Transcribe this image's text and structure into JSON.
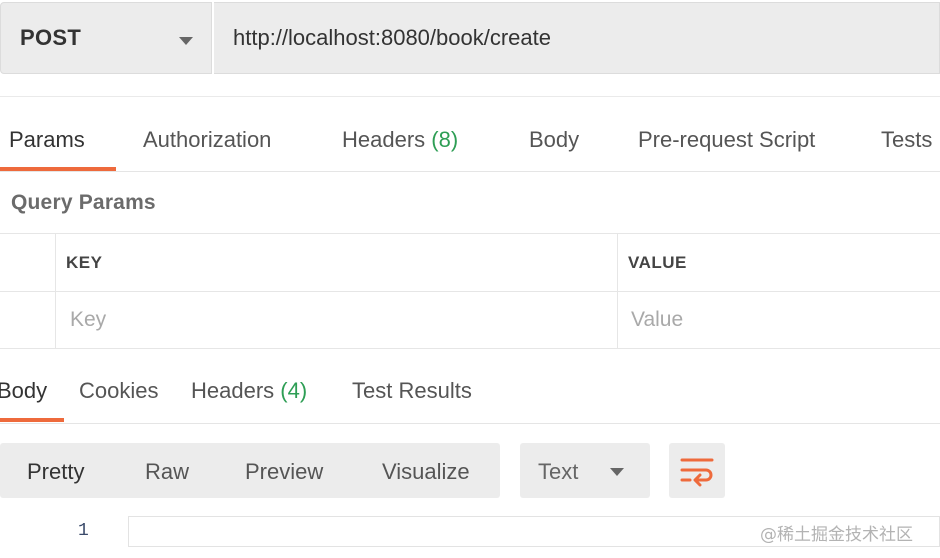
{
  "request": {
    "method": "POST",
    "url": "http://localhost:8080/book/create"
  },
  "request_tabs": {
    "params": "Params",
    "authorization": "Authorization",
    "headers_label": "Headers",
    "headers_count": "(8)",
    "body": "Body",
    "prerequest": "Pre-request Script",
    "tests": "Tests"
  },
  "query_params": {
    "title": "Query Params",
    "key_header": "KEY",
    "value_header": "VALUE",
    "key_placeholder": "Key",
    "value_placeholder": "Value"
  },
  "response_tabs": {
    "body": "Body",
    "cookies": "Cookies",
    "headers_label": "Headers",
    "headers_count": "(4)",
    "test_results": "Test Results"
  },
  "body_toolbar": {
    "pretty": "Pretty",
    "raw": "Raw",
    "preview": "Preview",
    "visualize": "Visualize",
    "format": "Text",
    "wrap_icon": "wrap-lines-icon"
  },
  "editor": {
    "line_number": "1"
  },
  "watermark": "@稀土掘金技术社区",
  "colors": {
    "accent": "#ee6a3c",
    "count_green": "#2e9e55",
    "panel_gray": "#ececec"
  }
}
